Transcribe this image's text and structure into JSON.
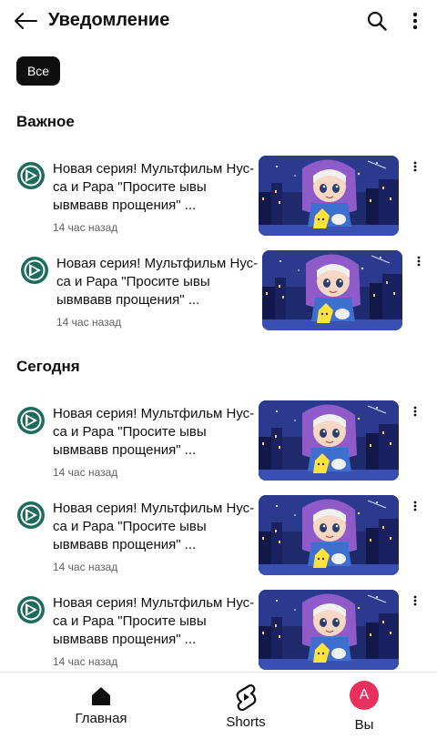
{
  "header": {
    "title": "Уведомление",
    "back_icon": "arrow-left-icon",
    "search_icon": "search-icon",
    "more_icon": "more-vert-icon"
  },
  "filter": {
    "chip_label": "Все"
  },
  "sections": [
    {
      "title": "Важное",
      "items": [
        {
          "title": "Новая серия! Мультфильм Нус-са и Рара \"Просите ывы ывмвавв прощения\" ...",
          "time": "14 час назад"
        },
        {
          "title": "Новая серия! Мультфильм Нус-са и Рара \"Просите ывы ывмвавв прощения\" ...",
          "time": "14 час назад"
        }
      ]
    },
    {
      "title": "Сегодня",
      "items": [
        {
          "title": "Новая серия! Мультфильм Нус-са и Рара \"Просите ывы ывмвавв прощения\" ...",
          "time": "14 час назад"
        },
        {
          "title": "Новая серия! Мультфильм Нус-са и Рара \"Просите ывы ывмвавв прощения\" ...",
          "time": "14 час назад"
        },
        {
          "title": "Новая серия! Мультфильм Нус-са и Рара \"Просите ывы ывмвавв прощения\" ...",
          "time": "14 час назад"
        }
      ]
    }
  ],
  "bottom_nav": {
    "home_label": "Главная",
    "shorts_label": "Shorts",
    "you_label": "Вы",
    "avatar_letter": "A"
  },
  "colors": {
    "avatar": "#e8305f",
    "channel_icon": "#1d6b5c",
    "chip_bg": "#0f0f0f"
  }
}
